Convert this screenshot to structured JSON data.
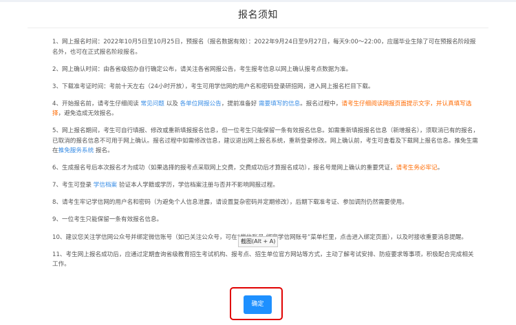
{
  "dialog": {
    "title": "报名须知"
  },
  "notice": {
    "item1": {
      "text": "1、网上报名时间：2022年10月5日至10月25日，预报名（报名数据有效）：2022年9月24日至9月27日，每天9:00～22:00，应届毕业生除了可在预报名阶段报名外，也可在正式报名阶段报名。"
    },
    "item2": {
      "text": "2、网上确认时间：由各省级招办自行确定公布，请关注各省网报公告，考生报考信息以网上确认报考点数据为准。"
    },
    "item3": {
      "text": "3、下载准考证时间：考前十天左右（24小时开放），考生可用学信网的用户名和密码登录研招网，进入网上报名栏目下载。"
    },
    "item4": {
      "p1": "4、开始报名前，请考生仔细阅读 ",
      "link1": "常见问题",
      "p2": " 以及 ",
      "link2": "各单位网报公告",
      "p3": "，提前准备好 ",
      "link3": "需要填写的信息",
      "p4": "。报名过程中，",
      "warn": "请考生仔细阅读网报页面提示文字，并认真填写选择",
      "p5": "，避免造成无效报名。"
    },
    "item5": {
      "p1": "5、网上报名期间，考生可自行填报、修改或重新填报报名信息，但一位考生只能保留一条有效报名信息。如需重新填报报名信息（新增报名），须取消已有的报名，已取消的报名信息不可用于网上确认。报名过程中如需修改信息，建议退出网上报名系统，重新登录修改。网上确认前，考生可查看及下载网上报名信息。推免生需在",
      "link": "推免服务系统",
      "p2": " 报名。"
    },
    "item6": {
      "p1": "6、生成报名号后本次报名才为成功（如果选择的报考点采取网上交费，交费成功后才算报名成功），报名号是网上确认的重要凭证，",
      "warn": "请考生务必牢记",
      "p2": "。"
    },
    "item7": {
      "p1": "7、考生可登录 ",
      "link": "学信档案",
      "p2": " 验证本人学籍或学历，学信档案注册与否并不影响网报过程。"
    },
    "item8": {
      "text": "8、请考生牢记学信网的用户名和密码（为避免个人信息泄露，请设置复杂密码并定期修改），后期下载准考证、参加调剂仍然需要使用。"
    },
    "item9": {
      "text": "9、一位考生只能保留一条有效报名信息。"
    },
    "item10": {
      "text": "10、建议您关注学信网公众号并绑定微信账号（如已关注公众号，可在“学信账号-绑定学信网账号”菜单栏里，点击进入绑定页面），以及时接收重要消息提醒。"
    },
    "item11": {
      "text": "11、考生网上报名成功后，应通过定期查询省级教育招生考试机构、报考点、招生单位官方网站等方式，主动了解考试安排、防疫要求等事项，积极配合完成相关工作。"
    }
  },
  "tooltip": {
    "text": "截图(Alt + A)"
  },
  "actions": {
    "confirm_label": "确定"
  },
  "colors": {
    "link": "#3a8ee6",
    "warning": "#ff6a00",
    "primary_button": "#1e90ff",
    "highlight_border": "#e00000"
  }
}
